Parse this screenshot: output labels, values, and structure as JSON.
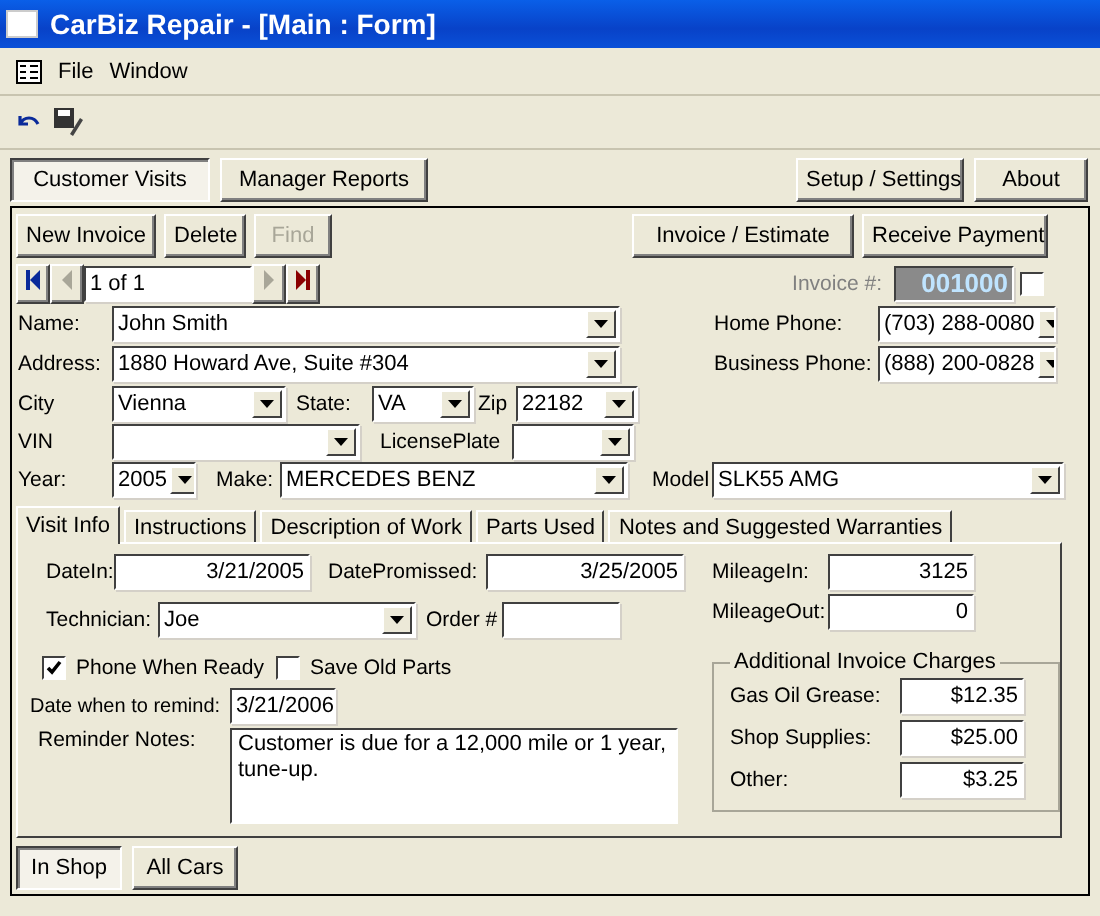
{
  "window": {
    "title": "CarBiz Repair - [Main : Form]"
  },
  "menu": [
    "File",
    "Window"
  ],
  "main_tabs": [
    {
      "label": "Customer Visits",
      "selected": true
    },
    {
      "label": "Manager Reports",
      "selected": false
    }
  ],
  "top_buttons": [
    "Setup / Settings",
    "About"
  ],
  "record_buttons": [
    {
      "label": "New Invoice",
      "disabled": false
    },
    {
      "label": "Delete",
      "disabled": false
    },
    {
      "label": "Find",
      "disabled": true
    }
  ],
  "invoice_buttons": [
    "Invoice / Estimate",
    "Receive Payment"
  ],
  "navigator": {
    "position": "1 of 1",
    "buttons": [
      {
        "kind": "first",
        "disabled": false
      },
      {
        "kind": "previous",
        "disabled": true
      },
      {
        "kind": "next",
        "disabled": true
      },
      {
        "kind": "last",
        "disabled": false
      }
    ]
  },
  "invoice": {
    "label": "Invoice #:",
    "value": "001000",
    "checked": false
  },
  "customer": {
    "name": {
      "label": "Name:",
      "value": "John Smith"
    },
    "address": {
      "label": "Address:",
      "value": "1880 Howard Ave, Suite #304"
    },
    "city": {
      "label": "City",
      "value": "Vienna"
    },
    "state": {
      "label": "State:",
      "value": "VA"
    },
    "zip": {
      "label": "Zip",
      "value": "22182"
    },
    "vin": {
      "label": "VIN"
    },
    "license_plate": {
      "label": "LicensePlate"
    },
    "year": {
      "label": "Year:",
      "value": "2005"
    },
    "make": {
      "label": "Make:",
      "value": "MERCEDES BENZ"
    },
    "model": {
      "label": "Model",
      "value": "SLK55 AMG"
    },
    "home_phone": {
      "label": "Home Phone:",
      "value": "(703) 288-0080"
    },
    "business_phone": {
      "label": "Business Phone:",
      "value": "(888) 200-0828"
    }
  },
  "visit_tabs": [
    {
      "label": "Visit Info",
      "selected": true
    },
    {
      "label": "Instructions",
      "selected": false
    },
    {
      "label": "Description of Work",
      "selected": false
    },
    {
      "label": "Parts Used",
      "selected": false
    },
    {
      "label": "Notes and Suggested Warranties",
      "selected": false
    }
  ],
  "visit_info": {
    "date_in": {
      "label": "DateIn:",
      "value": "3/21/2005"
    },
    "date_promised": {
      "label": "DatePromissed:",
      "value": "3/25/2005"
    },
    "mileage_in": {
      "label": "MileageIn:",
      "value": "3125"
    },
    "mileage_out": {
      "label": "MileageOut:",
      "value": "0"
    },
    "technician": {
      "label": "Technician:",
      "value": "Joe"
    },
    "order": {
      "label": "Order #"
    },
    "options": [
      {
        "label": "Phone When Ready",
        "checked": true
      },
      {
        "label": "Save Old Parts",
        "checked": false
      }
    ],
    "remind_date": {
      "label": "Date when to remind:",
      "value": "3/21/2006"
    },
    "reminder_notes": {
      "label": "Reminder Notes:",
      "value": "Customer is due for a 12,000 mile or 1 year, tune-up."
    },
    "charges": {
      "title": "Additional Invoice Charges",
      "items": [
        {
          "label": "Gas Oil Grease:",
          "value": "$12.35"
        },
        {
          "label": "Shop Supplies:",
          "value": "$25.00"
        },
        {
          "label": "Other:",
          "value": "$3.25"
        }
      ]
    }
  },
  "bottom_tabs": [
    {
      "label": "In Shop",
      "selected": true
    },
    {
      "label": "All Cars",
      "selected": false
    }
  ]
}
